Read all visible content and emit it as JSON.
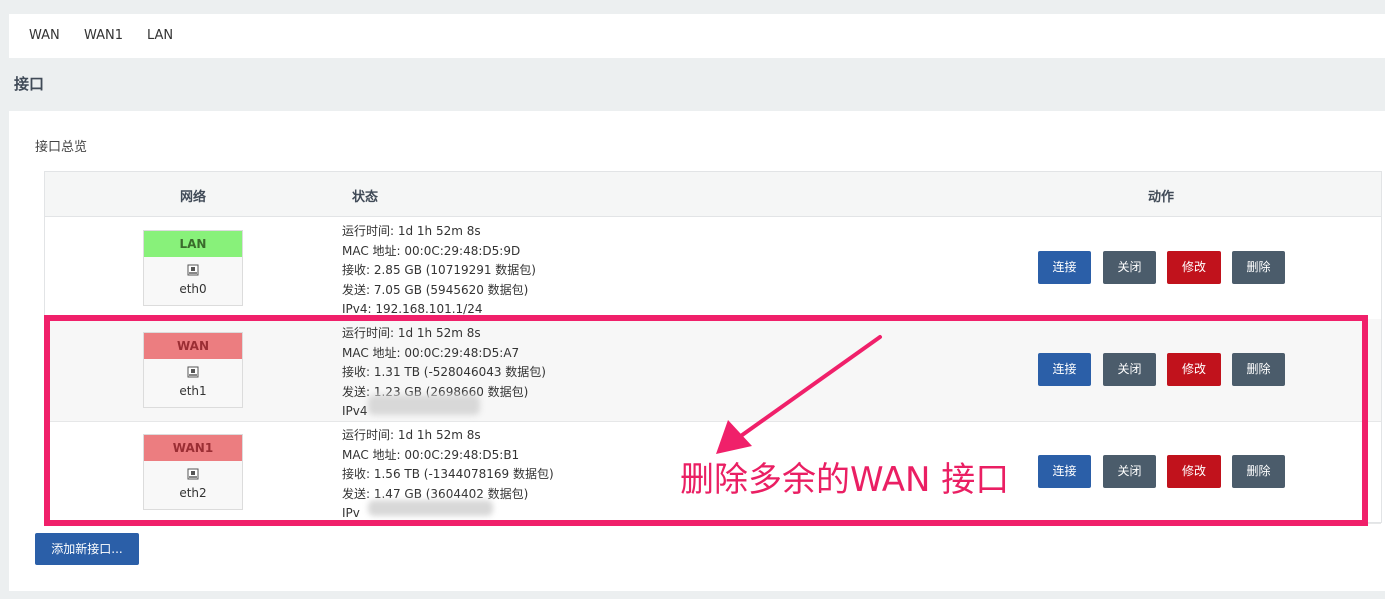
{
  "tabs": [
    "WAN",
    "WAN1",
    "LAN"
  ],
  "section_title": "接口",
  "panel_legend": "接口总览",
  "table": {
    "headers": {
      "network": "网络",
      "status": "状态",
      "actions": "动作"
    },
    "rows": [
      {
        "badge": "LAN",
        "badge_color": "#88f17a",
        "device": "eth0",
        "status": [
          "运行时间: 1d 1h 52m 8s",
          "MAC 地址: 00:0C:29:48:D5:9D",
          "接收: 2.85 GB (10719291 数据包)",
          "发送: 7.05 GB (5945620 数据包)",
          "IPv4: 192.168.101.1/24"
        ]
      },
      {
        "badge": "WAN",
        "badge_color": "#ec7d80",
        "device": "eth1",
        "status": [
          "运行时间: 1d 1h 52m 8s",
          "MAC 地址: 00:0C:29:48:D5:A7",
          "接收: 1.31 TB (-528046043 数据包)",
          "发送: 1.23 GB (2698660 数据包)",
          "IPv4"
        ]
      },
      {
        "badge": "WAN1",
        "badge_color": "#ec7d80",
        "device": "eth2",
        "status": [
          "运行时间: 1d 1h 52m 8s",
          "MAC 地址: 00:0C:29:48:D5:B1",
          "接收: 1.56 TB (-1344078169 数据包)",
          "发送: 1.47 GB (3604402 数据包)",
          "IPv"
        ]
      }
    ],
    "buttons": {
      "connect": "连接",
      "stop": "关闭",
      "edit": "修改",
      "delete": "删除"
    }
  },
  "add_button": "添加新接口...",
  "annotation": "删除多余的WAN 接口",
  "colors": {
    "primary": "#2b5fa8",
    "danger": "#c1121c",
    "neutral": "#4b5c6b",
    "highlight": "#f0206a"
  }
}
